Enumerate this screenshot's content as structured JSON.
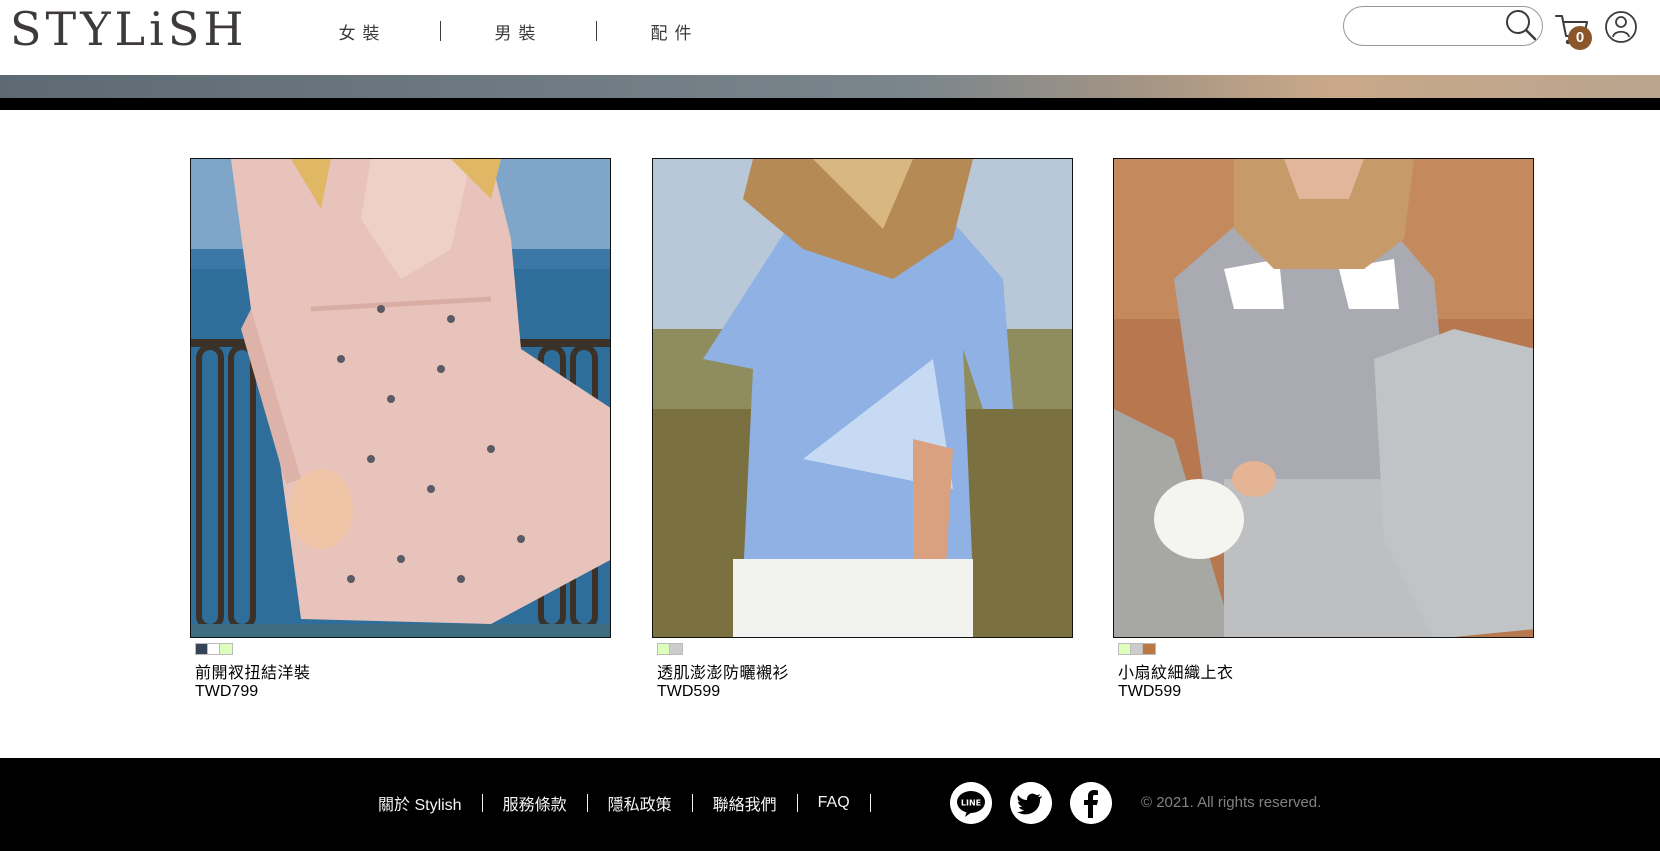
{
  "header": {
    "logo": "STYLiSH",
    "nav": [
      "女裝",
      "男裝",
      "配件"
    ],
    "search": {
      "value": "",
      "placeholder": ""
    },
    "cart_count": "0"
  },
  "products": [
    {
      "title": "前開衩扭結洋裝",
      "price": "TWD799",
      "colors": [
        "#334455",
        "#FFFFFF",
        "#DDFFBB"
      ]
    },
    {
      "title": "透肌澎澎防曬襯衫",
      "price": "TWD599",
      "colors": [
        "#DDFFBB",
        "#CCCCCC"
      ]
    },
    {
      "title": "小扇紋細織上衣",
      "price": "TWD599",
      "colors": [
        "#DDFFBB",
        "#CCCCCC",
        "#BB7744"
      ]
    }
  ],
  "footer": {
    "links": [
      "關於 Stylish",
      "服務條款",
      "隱私政策",
      "聯絡我們",
      "FAQ"
    ],
    "copyright": "© 2021. All rights reserved."
  },
  "colors": {
    "brand_text": "#3f3a3a",
    "badge": "#8b572a",
    "footer_bg": "#000000"
  },
  "icons": [
    "search-icon",
    "cart-icon",
    "member-icon",
    "line-icon",
    "twitter-icon",
    "facebook-icon"
  ]
}
